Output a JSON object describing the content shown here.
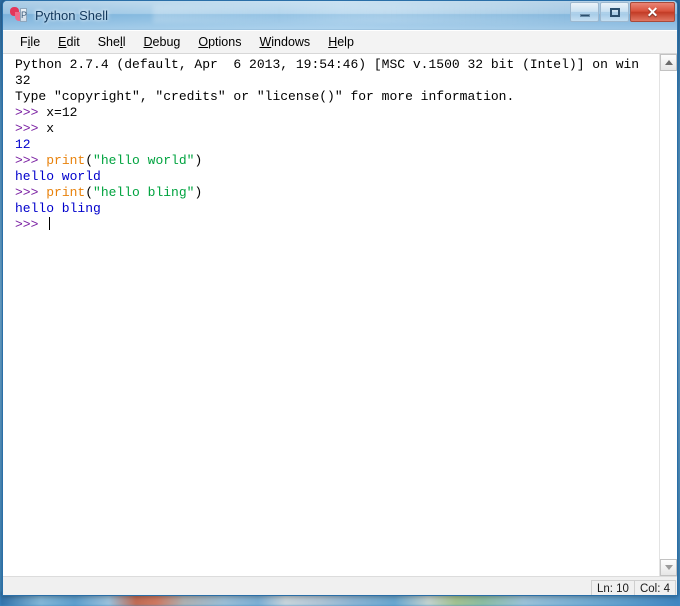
{
  "window": {
    "title": "Python Shell",
    "icon": "python-idle-icon",
    "controls": [
      {
        "name": "minimize-button",
        "glyph": "—"
      },
      {
        "name": "maximize-button",
        "glyph": "□"
      },
      {
        "name": "close-button",
        "glyph": "✕"
      }
    ]
  },
  "menu": {
    "items": [
      {
        "label": "File",
        "pre": "F",
        "acc": "i",
        "post": "le"
      },
      {
        "label": "Edit",
        "pre": "",
        "acc": "E",
        "post": "dit"
      },
      {
        "label": "Shell",
        "pre": "She",
        "acc": "l",
        "post": "l"
      },
      {
        "label": "Debug",
        "pre": "",
        "acc": "D",
        "post": "ebug"
      },
      {
        "label": "Options",
        "pre": "",
        "acc": "O",
        "post": "ptions"
      },
      {
        "label": "Windows",
        "pre": "",
        "acc": "W",
        "post": "indows"
      },
      {
        "label": "Help",
        "pre": "",
        "acc": "H",
        "post": "elp"
      }
    ]
  },
  "shell": {
    "lines": [
      {
        "segments": [
          {
            "text": "Python 2.7.4 (default, Apr  6 2013, 19:54:46) [MSC v.1500 32 bit (Intel)] on win",
            "style": "plain"
          }
        ]
      },
      {
        "segments": [
          {
            "text": "32",
            "style": "plain"
          }
        ]
      },
      {
        "segments": [
          {
            "text": "Type \"copyright\", \"credits\" or \"license()\" for more information.",
            "style": "plain"
          }
        ]
      },
      {
        "segments": [
          {
            "text": ">>> ",
            "style": "prompt"
          },
          {
            "text": "x=12",
            "style": "plain"
          }
        ]
      },
      {
        "segments": [
          {
            "text": ">>> ",
            "style": "prompt"
          },
          {
            "text": "x",
            "style": "plain"
          }
        ]
      },
      {
        "segments": [
          {
            "text": "12",
            "style": "output"
          }
        ]
      },
      {
        "segments": [
          {
            "text": ">>> ",
            "style": "prompt"
          },
          {
            "text": "print",
            "style": "builtin"
          },
          {
            "text": "(",
            "style": "plain"
          },
          {
            "text": "\"hello world\"",
            "style": "string"
          },
          {
            "text": ")",
            "style": "plain"
          }
        ]
      },
      {
        "segments": [
          {
            "text": "hello world",
            "style": "output"
          }
        ]
      },
      {
        "segments": [
          {
            "text": ">>> ",
            "style": "prompt"
          },
          {
            "text": "print",
            "style": "builtin"
          },
          {
            "text": "(",
            "style": "plain"
          },
          {
            "text": "\"hello bling\"",
            "style": "string"
          },
          {
            "text": ")",
            "style": "plain"
          }
        ]
      },
      {
        "segments": [
          {
            "text": "hello bling",
            "style": "output"
          }
        ]
      },
      {
        "segments": [
          {
            "text": ">>> ",
            "style": "prompt"
          }
        ],
        "caret": true
      }
    ]
  },
  "scrollbar": {
    "up_arrow": "scroll-up-arrow-icon",
    "down_arrow": "scroll-down-arrow-icon"
  },
  "status": {
    "line": "Ln: 10",
    "column": "Col: 4"
  },
  "colors": {
    "prompt": "#7a1fa2",
    "builtin": "#e8820c",
    "string": "#00a33f",
    "output": "#0000cc",
    "plain": "#000000",
    "titlebar_accent": "#4e93c8",
    "close_button": "#c23b26"
  }
}
